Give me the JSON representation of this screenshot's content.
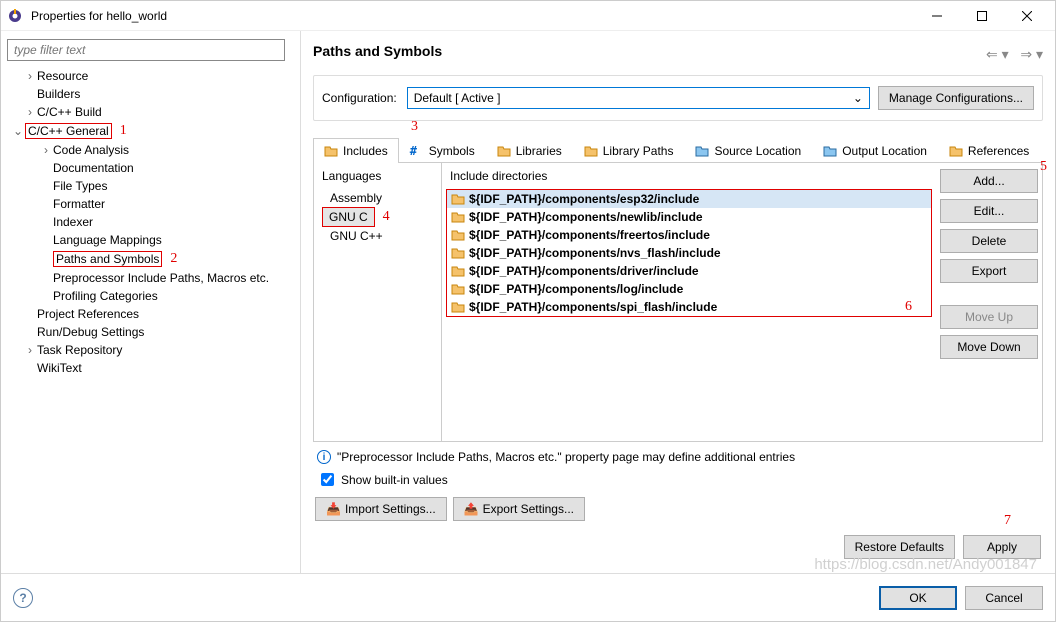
{
  "window": {
    "title": "Properties for hello_world"
  },
  "filter": {
    "placeholder": "type filter text"
  },
  "tree": {
    "resource": "Resource",
    "builders": "Builders",
    "ccbuild": "C/C++ Build",
    "ccgeneral": "C/C++ General",
    "code_analysis": "Code Analysis",
    "documentation": "Documentation",
    "file_types": "File Types",
    "formatter": "Formatter",
    "indexer": "Indexer",
    "language_mappings": "Language Mappings",
    "paths_symbols": "Paths and Symbols",
    "preproc": "Preprocessor Include Paths, Macros etc.",
    "profiling": "Profiling Categories",
    "project_refs": "Project References",
    "run_debug": "Run/Debug Settings",
    "task_repo": "Task Repository",
    "wikitext": "WikiText"
  },
  "annotations": {
    "a1": "1",
    "a2": "2",
    "a3": "3",
    "a4": "4",
    "a5": "5",
    "a6": "6",
    "a7": "7"
  },
  "main": {
    "heading": "Paths and Symbols",
    "config_label": "Configuration:",
    "config_value": "Default  [ Active ]",
    "manage_btn": "Manage Configurations..."
  },
  "tabs": {
    "includes": "Includes",
    "symbols": "Symbols",
    "libraries": "Libraries",
    "library_paths": "Library Paths",
    "source_location": "Source Location",
    "output_location": "Output Location",
    "references": "References"
  },
  "languages": {
    "title": "Languages",
    "items": [
      "Assembly",
      "GNU C",
      "GNU C++"
    ],
    "selected": "GNU C"
  },
  "includes": {
    "title": "Include directories",
    "items": [
      "${IDF_PATH}/components/esp32/include",
      "${IDF_PATH}/components/newlib/include",
      "${IDF_PATH}/components/freertos/include",
      "${IDF_PATH}/components/nvs_flash/include",
      "${IDF_PATH}/components/driver/include",
      "${IDF_PATH}/components/log/include",
      "${IDF_PATH}/components/spi_flash/include"
    ]
  },
  "side_buttons": {
    "add": "Add...",
    "edit": "Edit...",
    "delete": "Delete",
    "export": "Export",
    "move_up": "Move Up",
    "move_down": "Move Down"
  },
  "info_text": "\"Preprocessor Include Paths, Macros etc.\" property page may define additional entries",
  "show_builtin": "Show built-in values",
  "import_btn": "Import Settings...",
  "export_btn": "Export Settings...",
  "restore_btn": "Restore Defaults",
  "apply_btn": "Apply",
  "ok_btn": "OK",
  "cancel_btn": "Cancel",
  "watermark": "https://blog.csdn.net/Andy001847"
}
